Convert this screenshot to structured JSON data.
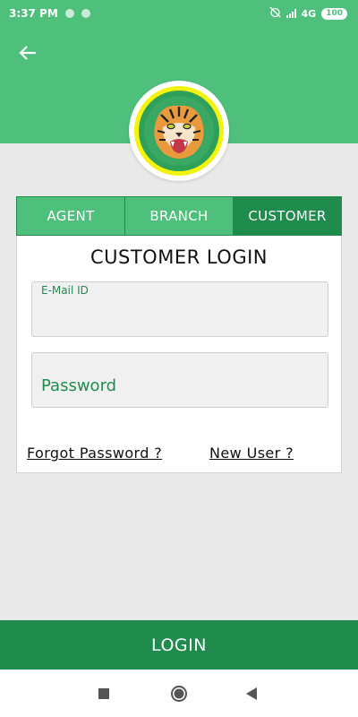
{
  "status_bar": {
    "time": "3:37 PM",
    "network": "4G",
    "battery": "100"
  },
  "header": {
    "back_icon": "arrow-left-icon",
    "logo_icon": "tiger-logo"
  },
  "tabs": [
    {
      "label": "AGENT",
      "active": false
    },
    {
      "label": "BRANCH",
      "active": false
    },
    {
      "label": "CUSTOMER",
      "active": true
    }
  ],
  "login_form": {
    "title": "CUSTOMER LOGIN",
    "email_label": "E-Mail ID",
    "email_value": "",
    "password_placeholder": "Password",
    "forgot_password": "Forgot Password ?",
    "new_user": "New User ?"
  },
  "login_button": "LOGIN",
  "colors": {
    "primary_light": "#4fbf7c",
    "primary_dark": "#1f8c4e",
    "logo_ring": "#f3f30b"
  },
  "nav_bar": {
    "icons": [
      "recent-apps-icon",
      "home-icon",
      "back-triangle-icon"
    ]
  }
}
